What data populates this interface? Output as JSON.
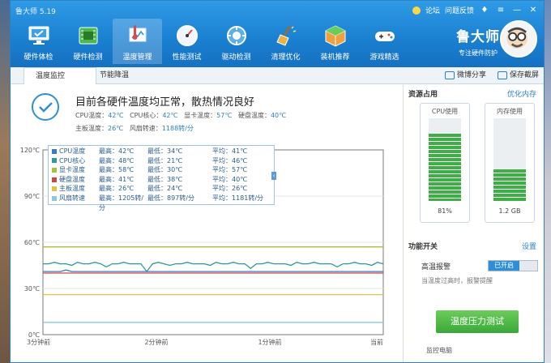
{
  "window": {
    "title": "鲁大师 5.19"
  },
  "top_links": {
    "forum": "论坛",
    "feedback": "问题反馈"
  },
  "nav": [
    {
      "label": "硬件体检",
      "icon": "monitor-check-icon"
    },
    {
      "label": "硬件检测",
      "icon": "circuit-board-icon"
    },
    {
      "label": "温度管理",
      "icon": "thermometer-icon",
      "active": true
    },
    {
      "label": "性能测试",
      "icon": "speedometer-icon"
    },
    {
      "label": "驱动检测",
      "icon": "driver-gear-icon"
    },
    {
      "label": "清理优化",
      "icon": "broom-icon"
    },
    {
      "label": "装机推荐",
      "icon": "box-icon"
    },
    {
      "label": "游戏精选",
      "icon": "gamepad-icon"
    }
  ],
  "brand": {
    "name": "鲁大师",
    "slogan": "专注硬件防护"
  },
  "tabs": [
    {
      "label": "温度监控",
      "active": true
    },
    {
      "label": "节能降温"
    }
  ],
  "share": {
    "weibo": "微博分享",
    "screenshot": "保存截屏"
  },
  "status": {
    "title": "目前各硬件温度均正常，散热情况良好",
    "cpu_temp_label": "CPU温度：",
    "cpu_temp": "42℃",
    "cpu_core_label": "CPU核心：",
    "cpu_core": "42℃",
    "gpu_label": "显卡温度：",
    "gpu": "57℃",
    "disk_label": "硬盘温度：",
    "disk": "40℃",
    "board_label": "主板温度：",
    "board": "26℃",
    "fan_label": "风扇转速：",
    "fan": "1188转/分"
  },
  "legend": [
    {
      "name": "CPU温度",
      "max": "最高：42℃",
      "min": "最低：34℃",
      "avg": "平均：41℃",
      "color": "#3c78c8"
    },
    {
      "name": "CPU核心",
      "max": "最高：48℃",
      "min": "最低：21℃",
      "avg": "平均：46℃",
      "color": "#2a9a9a"
    },
    {
      "name": "显卡温度",
      "max": "最高：58℃",
      "min": "最低：30℃",
      "avg": "平均：57℃",
      "color": "#a8c23a"
    },
    {
      "name": "硬盘温度",
      "max": "最高：41℃",
      "min": "最低：38℃",
      "avg": "平均：40℃",
      "color": "#c84848"
    },
    {
      "name": "主板温度",
      "max": "最高：26℃",
      "min": "最低：24℃",
      "avg": "平均：26℃",
      "color": "#e0c44a"
    },
    {
      "name": "风扇转速",
      "max": "最高：1205转/分",
      "min": "最低：897转/分",
      "avg": "平均：1181转/分",
      "color": "#8ac8e8"
    }
  ],
  "chart_data": {
    "type": "line",
    "x_ticks": [
      "3分钟前",
      "2分钟前",
      "1分钟前",
      "当前"
    ],
    "y_ticks": [
      "0℃",
      "30℃",
      "60℃",
      "90℃",
      "120℃"
    ],
    "ylim": [
      0,
      120
    ],
    "x_count": 60,
    "series": [
      {
        "name": "显卡温度",
        "color": "#a8c23a",
        "values": [
          57,
          57,
          57,
          57,
          57,
          57,
          57,
          57,
          57,
          57,
          57,
          57,
          57,
          57,
          57,
          57,
          57,
          57,
          57,
          57,
          57,
          57,
          57,
          57,
          57,
          57,
          57,
          57,
          57,
          57,
          57,
          57,
          57,
          57,
          57,
          57,
          57,
          57,
          57,
          57,
          57,
          57,
          57,
          57,
          57,
          57,
          57,
          57,
          57,
          57,
          57,
          57,
          57,
          57,
          57,
          57,
          57,
          57,
          57,
          57
        ]
      },
      {
        "name": "CPU核心",
        "color": "#2a9a9a",
        "values": [
          46,
          46,
          47,
          46,
          46,
          45,
          47,
          46,
          46,
          47,
          46,
          44,
          46,
          46,
          47,
          46,
          46,
          46,
          41,
          46,
          47,
          46,
          45,
          46,
          46,
          47,
          46,
          46,
          46,
          45,
          47,
          46,
          46,
          47,
          46,
          46,
          43,
          46,
          46,
          47,
          46,
          46,
          46,
          45,
          47,
          46,
          46,
          47,
          46,
          46,
          46,
          44,
          46,
          46,
          47,
          46,
          46,
          45,
          47,
          46
        ]
      },
      {
        "name": "CPU温度",
        "color": "#3c78c8",
        "values": [
          41,
          41,
          41,
          41,
          42,
          41,
          41,
          41,
          41,
          41,
          41,
          41,
          41,
          41,
          41,
          41,
          41,
          41,
          41,
          41,
          41,
          41,
          41,
          41,
          41,
          41,
          41,
          41,
          41,
          41,
          41,
          41,
          41,
          41,
          41,
          41,
          41,
          41,
          41,
          41,
          41,
          41,
          41,
          41,
          41,
          41,
          41,
          41,
          41,
          41,
          41,
          41,
          41,
          41,
          41,
          41,
          41,
          41,
          41,
          41
        ]
      },
      {
        "name": "硬盘温度",
        "color": "#c84848",
        "values": [
          40,
          40,
          40,
          40,
          40,
          40,
          40,
          40,
          40,
          40,
          40,
          40,
          40,
          40,
          40,
          40,
          40,
          40,
          40,
          40,
          40,
          40,
          40,
          40,
          40,
          40,
          40,
          40,
          40,
          40,
          40,
          40,
          40,
          40,
          40,
          40,
          40,
          40,
          40,
          40,
          40,
          40,
          40,
          40,
          40,
          40,
          40,
          40,
          40,
          40,
          40,
          40,
          40,
          40,
          40,
          40,
          40,
          40,
          40,
          40
        ]
      },
      {
        "name": "主板温度",
        "color": "#e0c44a",
        "values": [
          26,
          26,
          26,
          26,
          26,
          26,
          26,
          26,
          26,
          26,
          26,
          26,
          26,
          26,
          26,
          26,
          26,
          26,
          26,
          26,
          26,
          26,
          26,
          26,
          26,
          26,
          26,
          26,
          26,
          26,
          26,
          26,
          26,
          26,
          26,
          26,
          26,
          26,
          26,
          26,
          26,
          26,
          26,
          26,
          26,
          26,
          26,
          26,
          26,
          26,
          26,
          26,
          26,
          26,
          26,
          26,
          26,
          26,
          26,
          26
        ]
      },
      {
        "name": "风扇转速",
        "color": "#8ac8e8",
        "values": [
          8,
          8,
          8,
          8,
          8,
          8,
          8,
          8,
          8,
          8,
          8,
          8,
          8,
          8,
          8,
          8,
          8,
          8,
          8,
          8,
          8,
          8,
          8,
          8,
          8,
          8,
          8,
          8,
          8,
          8,
          8,
          8,
          8,
          8,
          8,
          8,
          8,
          8,
          8,
          8,
          8,
          8,
          8,
          8,
          8,
          8,
          8,
          8,
          8,
          8,
          8,
          8,
          8,
          8,
          8,
          8,
          8,
          8,
          8,
          8
        ]
      }
    ]
  },
  "resources": {
    "title": "资源占用",
    "optimize": "优化内存",
    "cpu_label": "CPU使用",
    "cpu_value": "81%",
    "cpu_fraction": 0.81,
    "mem_label": "内存使用",
    "mem_value": "1.2 GB",
    "mem_fraction": 0.38
  },
  "features": {
    "title": "功能开关",
    "settings": "设置",
    "alarm_label": "高温报警",
    "alarm_state": "已开启",
    "alarm_desc": "当温度过高时，报警提醒",
    "test_button": "温度压力测试",
    "monitor_label": "监控电脑"
  }
}
